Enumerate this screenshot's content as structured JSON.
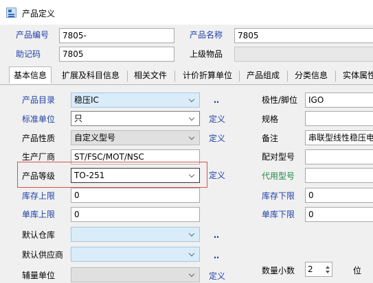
{
  "window": {
    "title": "产品定义"
  },
  "header": {
    "product_code_label": "产品编号",
    "product_code_value": "7805-",
    "product_name_label": "产品名称",
    "product_name_value": "7805",
    "mnemonic_label": "助记码",
    "mnemonic_value": "7805",
    "parent_item_label": "上级物品",
    "parent_item_value": ""
  },
  "tabs": [
    {
      "label": "基本信息"
    },
    {
      "label": "扩展及科目信息"
    },
    {
      "label": "相关文件"
    },
    {
      "label": "计价折算单位"
    },
    {
      "label": "产品组成"
    },
    {
      "label": "分类信息"
    },
    {
      "label": "实体属性"
    }
  ],
  "form": {
    "catalog": {
      "label": "产品目录",
      "value": "稳压IC",
      "action": "‥"
    },
    "std_unit": {
      "label": "标准单位",
      "value": "只",
      "action": "定义"
    },
    "nature": {
      "label": "产品性质",
      "value": "自定义型号",
      "action": "定义"
    },
    "manufacturer": {
      "label": "生产厂商",
      "value": "ST/FSC/MOT/NSC"
    },
    "grade": {
      "label": "产品等级",
      "value": "TO-251",
      "action": "定义"
    },
    "stock_max": {
      "label": "库存上限",
      "value": "0"
    },
    "unit_max": {
      "label": "单库上限",
      "value": "0"
    },
    "default_warehouse": {
      "label": "默认仓库",
      "value": "",
      "action": "‥"
    },
    "default_supplier": {
      "label": "默认供应商",
      "value": "",
      "action": "‥"
    },
    "aux_unit": {
      "label": "辅量单位",
      "value": "",
      "action": "定义"
    },
    "polarity": {
      "label": "极性/脚位",
      "value": "IGO"
    },
    "spec": {
      "label": "规格",
      "value": ""
    },
    "remark": {
      "label": "备注",
      "value": "串联型线性稳压电"
    },
    "matching_model": {
      "label": "配对型号",
      "value": ""
    },
    "substitute_model": {
      "label": "代用型号",
      "value": ""
    },
    "stock_min": {
      "label": "库存下限",
      "value": "0"
    },
    "unit_min": {
      "label": "单库下限",
      "value": "0"
    },
    "qty_decimals": {
      "label": "数量小数",
      "value": "2",
      "unit": "位"
    }
  },
  "colors": {
    "accent_blue": "#1e3fa8",
    "green_label": "#22884a",
    "highlight_red": "#de4c4c",
    "field_lightblue": "#d9ecf9"
  }
}
